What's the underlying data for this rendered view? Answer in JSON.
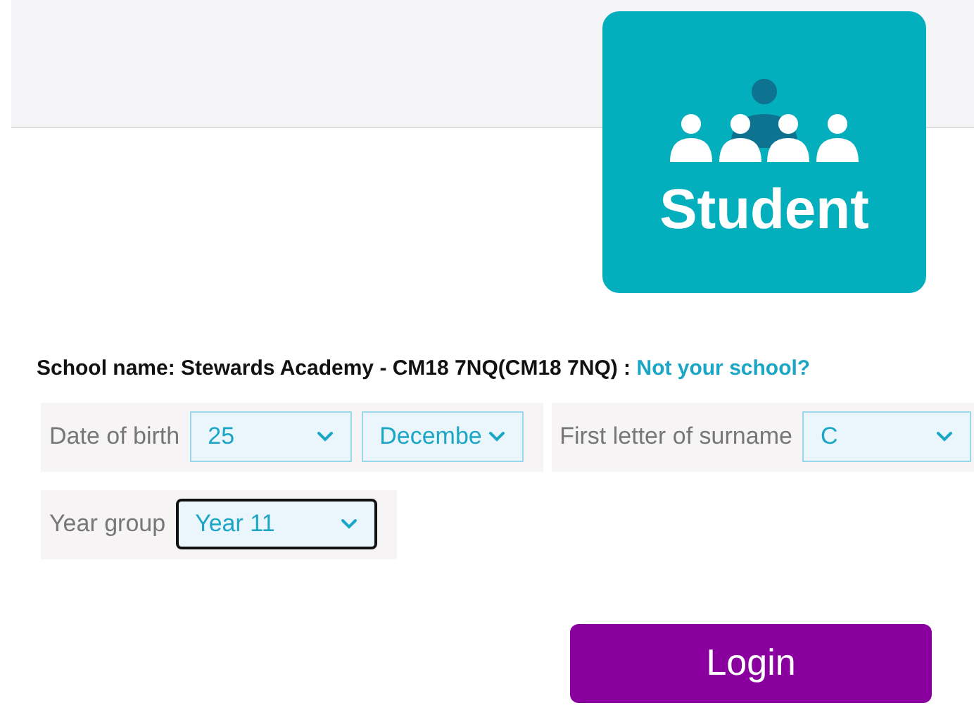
{
  "role_card": {
    "title": "Student"
  },
  "school": {
    "label": "School name: Stewards Academy - CM18 7NQ(CM18 7NQ) :",
    "link": "Not your school?"
  },
  "field_rows": [
    {
      "groups": [
        {
          "label": "Date of birth",
          "selects": [
            {
              "value": "25",
              "focused": false
            },
            {
              "value": "Decembe",
              "focused": false
            }
          ]
        },
        {
          "label": "First letter of surname",
          "selects": [
            {
              "value": "C",
              "focused": false
            }
          ]
        }
      ]
    },
    {
      "groups": [
        {
          "label": "Year group",
          "selects": [
            {
              "value": "Year 11",
              "focused": true
            }
          ]
        }
      ]
    }
  ],
  "login_button": "Login"
}
